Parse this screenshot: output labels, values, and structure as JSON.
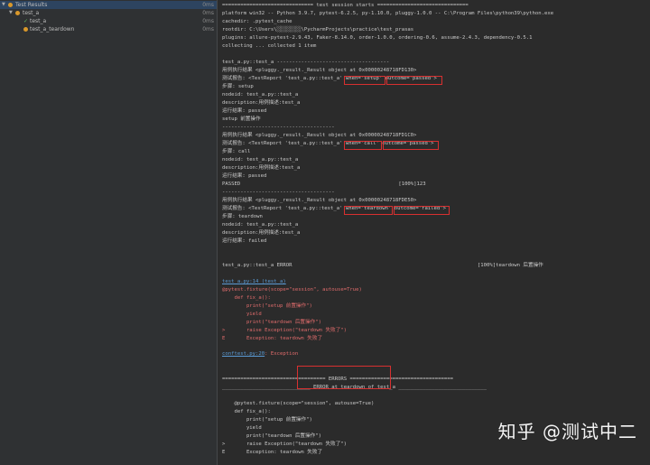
{
  "tree": {
    "root": {
      "label": "Test Results",
      "time": "0ms"
    },
    "file": {
      "label": "test_a",
      "time": "0ms"
    },
    "children": [
      {
        "label": "test_a",
        "time": "0ms",
        "status": "pass"
      },
      {
        "label": "test_a_teardown",
        "time": "0ms",
        "status": "error"
      }
    ]
  },
  "console": {
    "lines": [
      "============================== test session starts ==============================",
      "platform win32 -- Python 3.9.7, pytest-6.2.5, py-1.10.0, pluggy-1.0.0 -- C:\\Program Files\\python39\\python.exe",
      "cachedir: .pytest_cache",
      "rootdir: C:\\Users\\░░░░░░░░\\PycharmProjects\\practice\\test_prasas",
      "plugins: allure-pytest-2.9.43, Faker-8.14.0, order-1.0.0, ordering-0.6, assume-2.4.3, dependency-0.5.1",
      "collecting ... collected 1 item",
      "",
      "test_a.py::test_a -------------------------------------",
      "用例执行结果 <pluggy._result._Result object at 0x00000248718FD130>",
      "测试报告: <TestReport 'test_a.py::test_a' when='setup' outcome='passed'>",
      "步骤: setup",
      "nodeid: test_a.py::test_a",
      "description:用例描述:test_a",
      "运行结果: passed",
      "setup 前置操作",
      "-------------------------------------",
      "用例执行结果 <pluggy._result._Result object at 0x00000248718FD1C0>",
      "测试报告: <TestReport 'test_a.py::test_a' when='call' outcome='passed'>",
      "步骤: call",
      "nodeid: test_a.py::test_a",
      "description:用例描述:test_a",
      "运行结果: passed",
      "PASSED                                                    [100%]123",
      "-------------------------------------",
      "用例执行结果 <pluggy._result._Result object at 0x00000248718FDE50>",
      "测试报告: <TestReport 'test_a.py::test_a' when='teardown' outcome='failed'>",
      "步骤: teardown",
      "nodeid: test_a.py::test_a",
      "description:用例描述:test_a",
      "运行结果: failed",
      "",
      "test_a.py::test_a ERROR                                                             [100%]teardown 后置操作",
      "",
      "",
      "test_a.py:14 (test_a)",
      "@pytest.fixture(scope=\"session\", autouse=True)",
      "    def fix_a():",
      "        print(\"setup 前置操作\")",
      "        yield",
      "        print(\"teardown 后置操作\")",
      ">       raise Exception(\"teardown 失败了\")",
      "E       Exception: teardown 失败了",
      "",
      "conftest.py:20: Exception",
      "",
      "",
      "================================== ERRORS ==================================",
      "_____________________________ ERROR at teardown of test_a _____________________________",
      "",
      "    @pytest.fixture(scope=\"session\", autouse=True)",
      "    def fix_a():",
      "        print(\"setup 前置操作\")",
      "        yield",
      "        print(\"teardown 后置操作\")",
      ">       raise Exception(\"teardown 失败了\")",
      "E       Exception: teardown 失败了"
    ],
    "conftest_link": "conftest.py:20",
    "conftest_rest": ": Exception"
  },
  "watermark": "知乎 @测试中二",
  "colors": {
    "error": "#e06c6c",
    "link": "#5b9bd5",
    "highlight_box": "#d83030"
  }
}
